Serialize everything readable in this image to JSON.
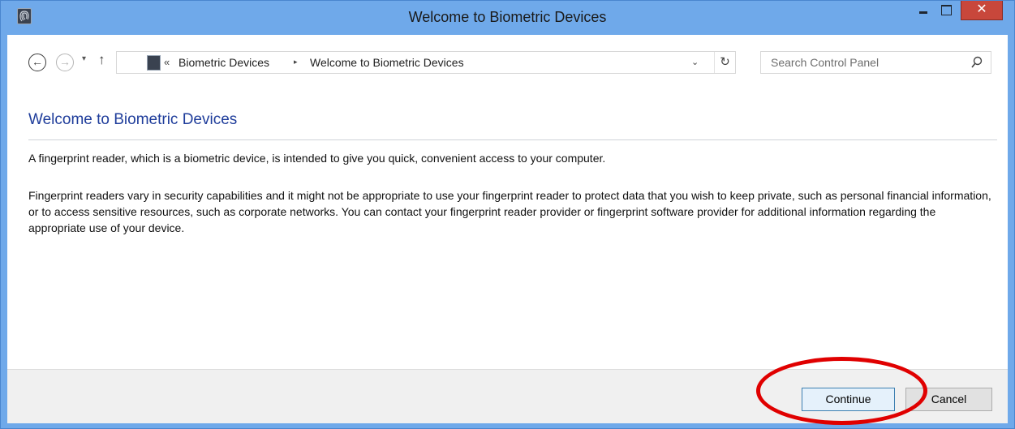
{
  "window": {
    "title": "Welcome to Biometric Devices",
    "controls": {
      "minimize": "–",
      "maximize": "☐",
      "close": "✕"
    },
    "accent_color": "#6fa9ea",
    "close_color": "#c8473b"
  },
  "nav": {
    "back_glyph": "←",
    "forward_glyph": "→",
    "history_glyph": "▾",
    "up_glyph": "↑",
    "address": {
      "separator": "«",
      "crumbs": [
        "Biometric Devices",
        "Welcome to Biometric Devices"
      ],
      "crumb_arrow": "▸",
      "dropdown_glyph": "⌄",
      "refresh_glyph": "↻"
    },
    "search": {
      "placeholder": "Search Control Panel",
      "icon": "search-icon"
    }
  },
  "main": {
    "heading": "Welcome to Biometric Devices",
    "heading_color": "#1f3d9b",
    "paragraphs": [
      "A fingerprint reader, which is a biometric device, is intended to give you quick, convenient access to your computer.",
      "Fingerprint readers vary in security capabilities and it might not be appropriate to use your fingerprint reader to protect data that you wish to keep private, such as personal financial information, or to access sensitive resources, such as corporate networks. You can contact your fingerprint reader provider or fingerprint software provider for additional information regarding the appropriate use of your device."
    ]
  },
  "footer": {
    "continue_label": "Continue",
    "cancel_label": "Cancel"
  },
  "annotation": {
    "ring_color": "#e00000"
  }
}
